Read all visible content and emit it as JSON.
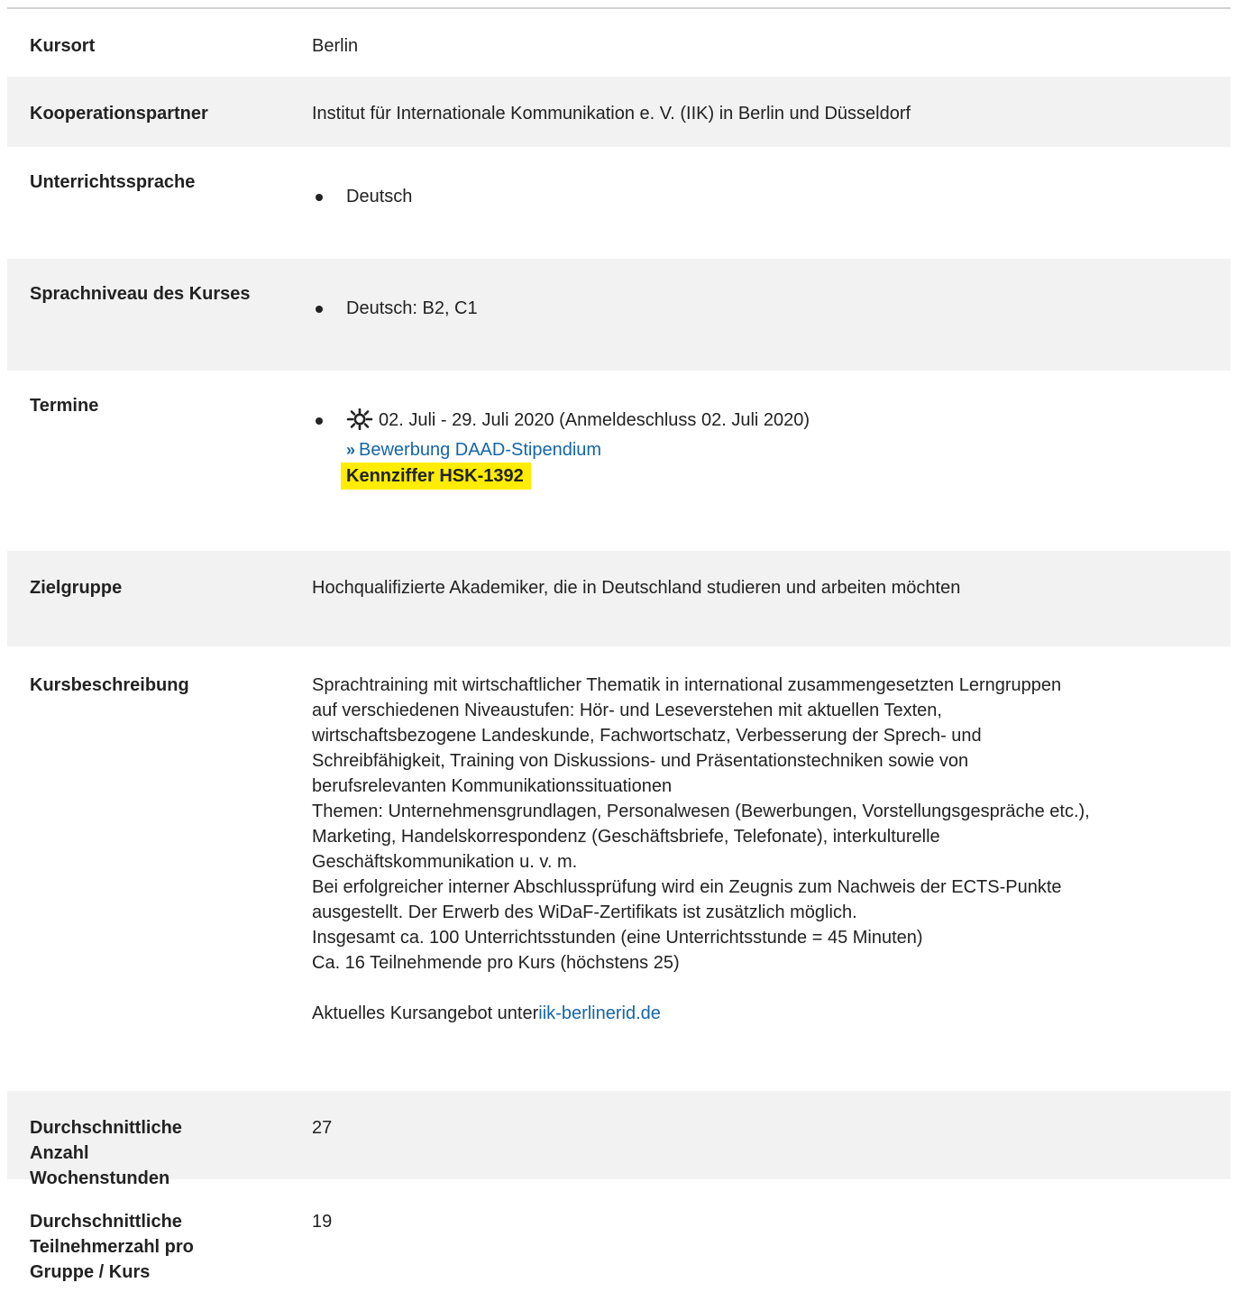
{
  "rows": {
    "kursort": {
      "label": "Kursort",
      "value": "Berlin"
    },
    "kooperation": {
      "label": "Kooperationspartner",
      "value": "Institut für Internationale Kommunikation e. V. (IIK) in Berlin und Düsseldorf"
    },
    "sprache": {
      "label": "Unterrichtssprache",
      "items": [
        "Deutsch"
      ]
    },
    "niveau": {
      "label": "Sprachniveau des Kurses",
      "items": [
        "Deutsch: B2, C1"
      ]
    },
    "termine": {
      "label": "Termine",
      "date": "02. Juli - 29. Juli 2020 (Anmeldeschluss 02. Juli 2020)",
      "link_text": "Bewerbung DAAD-Stipendium",
      "badge": "Kennziffer HSK-1392",
      "icon": "sun-icon"
    },
    "zielgruppe": {
      "label": "Zielgruppe",
      "value": "Hochqualifizierte Akademiker, die in Deutschland studieren und arbeiten möchten"
    },
    "beschreibung": {
      "label": "Kursbeschreibung",
      "lines": [
        "Sprachtraining mit wirtschaftlicher Thematik in international zusammengesetzten Lerngruppen",
        "auf verschiedenen Niveaustufen: Hör- und Leseverstehen mit aktuellen Texten,",
        "wirtschaftsbezogene Landeskunde, Fachwortschatz, Verbesserung der Sprech- und",
        "Schreibfähigkeit, Training von Diskussions- und Präsentationstechniken sowie von",
        "berufsrelevanten Kommunikationssituationen",
        "Themen: Unternehmensgrundlagen, Personalwesen (Bewerbungen, Vorstellungsgespräche etc.),",
        "Marketing, Handelskorrespondenz (Geschäftsbriefe, Telefonate), interkulturelle",
        "Geschäftskommunikation u. v. m.",
        "Bei erfolgreicher interner Abschlussprüfung wird ein Zeugnis zum Nachweis der ECTS-Punkte",
        "ausgestellt. Der Erwerb des WiDaF-Zertifikats ist zusätzlich möglich.",
        "Insgesamt ca. 100 Unterrichtsstunden (eine Unterrichtsstunde = 45 Minuten)",
        "Ca. 16 Teilnehmende pro Kurs (höchstens 25)"
      ],
      "offer_prefix": "Aktuelles Kursangebot unter",
      "offer_link": "iik-berlinerid.de"
    },
    "wochenstunden": {
      "label": "Durchschnittliche Anzahl Wochenstunden",
      "value": "27"
    },
    "teilnehmer": {
      "label": "Durchschnittliche Teilnehmerzahl pro Gruppe / Kurs",
      "value": "19"
    }
  },
  "colors": {
    "shade": "#f2f2f2",
    "link": "#1565a8",
    "badge": "#ffed00",
    "border": "#d2d2d2"
  }
}
